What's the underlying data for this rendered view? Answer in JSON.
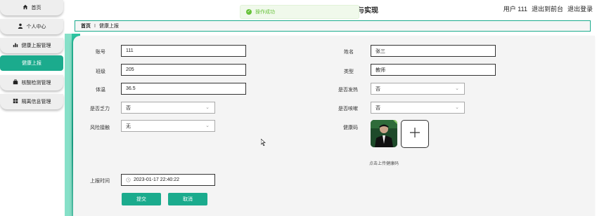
{
  "header": {
    "title": "与实现",
    "user_label": "用户 111",
    "back_to_front": "退出到前台",
    "logout": "退出登录"
  },
  "toast": {
    "icon": "check-circle-icon",
    "message": "操作成功",
    "color": "#67c23a"
  },
  "sidebar": {
    "items": [
      {
        "label": "首页",
        "icon": "home-icon",
        "active": false
      },
      {
        "label": "个人中心",
        "icon": "user-icon",
        "active": false
      },
      {
        "label": "健康上报管理",
        "icon": "bar-chart-icon",
        "active": false
      },
      {
        "label": "健康上报",
        "icon": "",
        "active": true
      },
      {
        "label": "核酸检测管理",
        "icon": "briefcase-icon",
        "active": false
      },
      {
        "label": "隔离信息管理",
        "icon": "grid-icon",
        "active": false
      }
    ],
    "accent": "#1bab8d"
  },
  "breadcrumb": {
    "home": "首页",
    "separator": "Ι",
    "current": "健康上报"
  },
  "form": {
    "account": {
      "label": "账号",
      "value": "111"
    },
    "name": {
      "label": "姓名",
      "value": "张三"
    },
    "class": {
      "label": "班级",
      "value": "205"
    },
    "type": {
      "label": "类型",
      "value": "教师"
    },
    "temperature": {
      "label": "体温",
      "value": "36.5"
    },
    "fever": {
      "label": "是否发热",
      "value": "否"
    },
    "fatigue": {
      "label": "是否乏力",
      "value": "否"
    },
    "cough": {
      "label": "是否咳嗽",
      "value": "否"
    },
    "risk_contact": {
      "label": "风险接触",
      "value": "无"
    },
    "health_code": {
      "label": "健康码",
      "upload_hint": "点击上传健康码",
      "upload_icon": "plus-icon"
    },
    "report_time": {
      "label": "上报时间",
      "value": "2023-01-17 22:40:22",
      "icon": "clock-icon"
    },
    "submit": "提交",
    "cancel": "取消"
  }
}
